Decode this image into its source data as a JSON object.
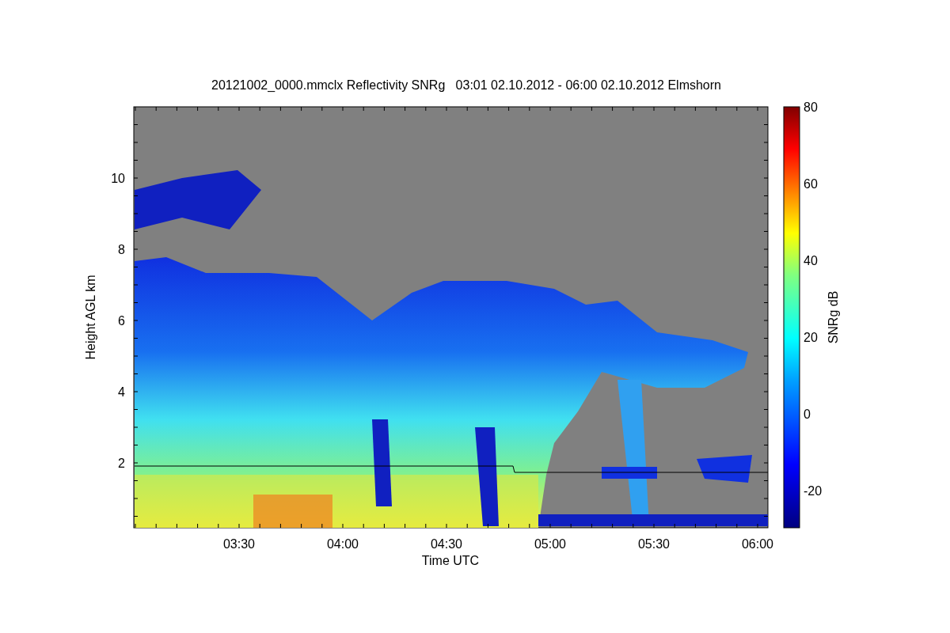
{
  "figure": {
    "title": "20121002_0000.mmclx Reflectivity SNRg   03:01 02.10.2012 - 06:00 02.10.2012 Elmshorn",
    "xlabel": "Time UTC",
    "ylabel": "Height AGL km",
    "xticks": [
      "03:30",
      "04:00",
      "04:30",
      "05:00",
      "05:30",
      "06:00"
    ],
    "yticks": [
      "10",
      "8",
      "6",
      "4",
      "2"
    ],
    "colorbar": {
      "label": "SNRg dB",
      "ticks": [
        "80",
        "60",
        "40",
        "20",
        "0",
        "-20"
      ]
    }
  }
}
